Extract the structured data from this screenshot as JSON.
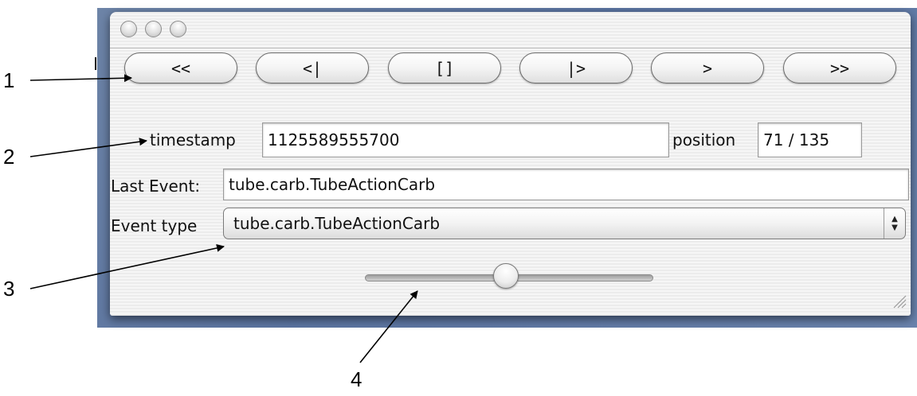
{
  "toolbar": {
    "buttons": [
      {
        "label": "<<"
      },
      {
        "label": "<|"
      },
      {
        "label": "[]"
      },
      {
        "label": "|>"
      },
      {
        "label": ">"
      },
      {
        "label": ">>"
      }
    ]
  },
  "timestamp": {
    "label": "timestamp",
    "value": "1125589555700"
  },
  "position": {
    "label": "position",
    "value": "71 / 135"
  },
  "last_event": {
    "label": "Last Event:",
    "value": "tube.carb.TubeActionCarb"
  },
  "event_type": {
    "label": "Event type",
    "selected": "tube.carb.TubeActionCarb"
  },
  "slider": {
    "fraction": 0.49
  },
  "callouts": [
    "1",
    "2",
    "3",
    "4"
  ],
  "icons": {
    "window_controls": [
      "window-close-icon",
      "window-minimize-icon",
      "window-zoom-icon"
    ],
    "stepper": "up-down-stepper-icon",
    "resize": "resize-grip-icon"
  }
}
